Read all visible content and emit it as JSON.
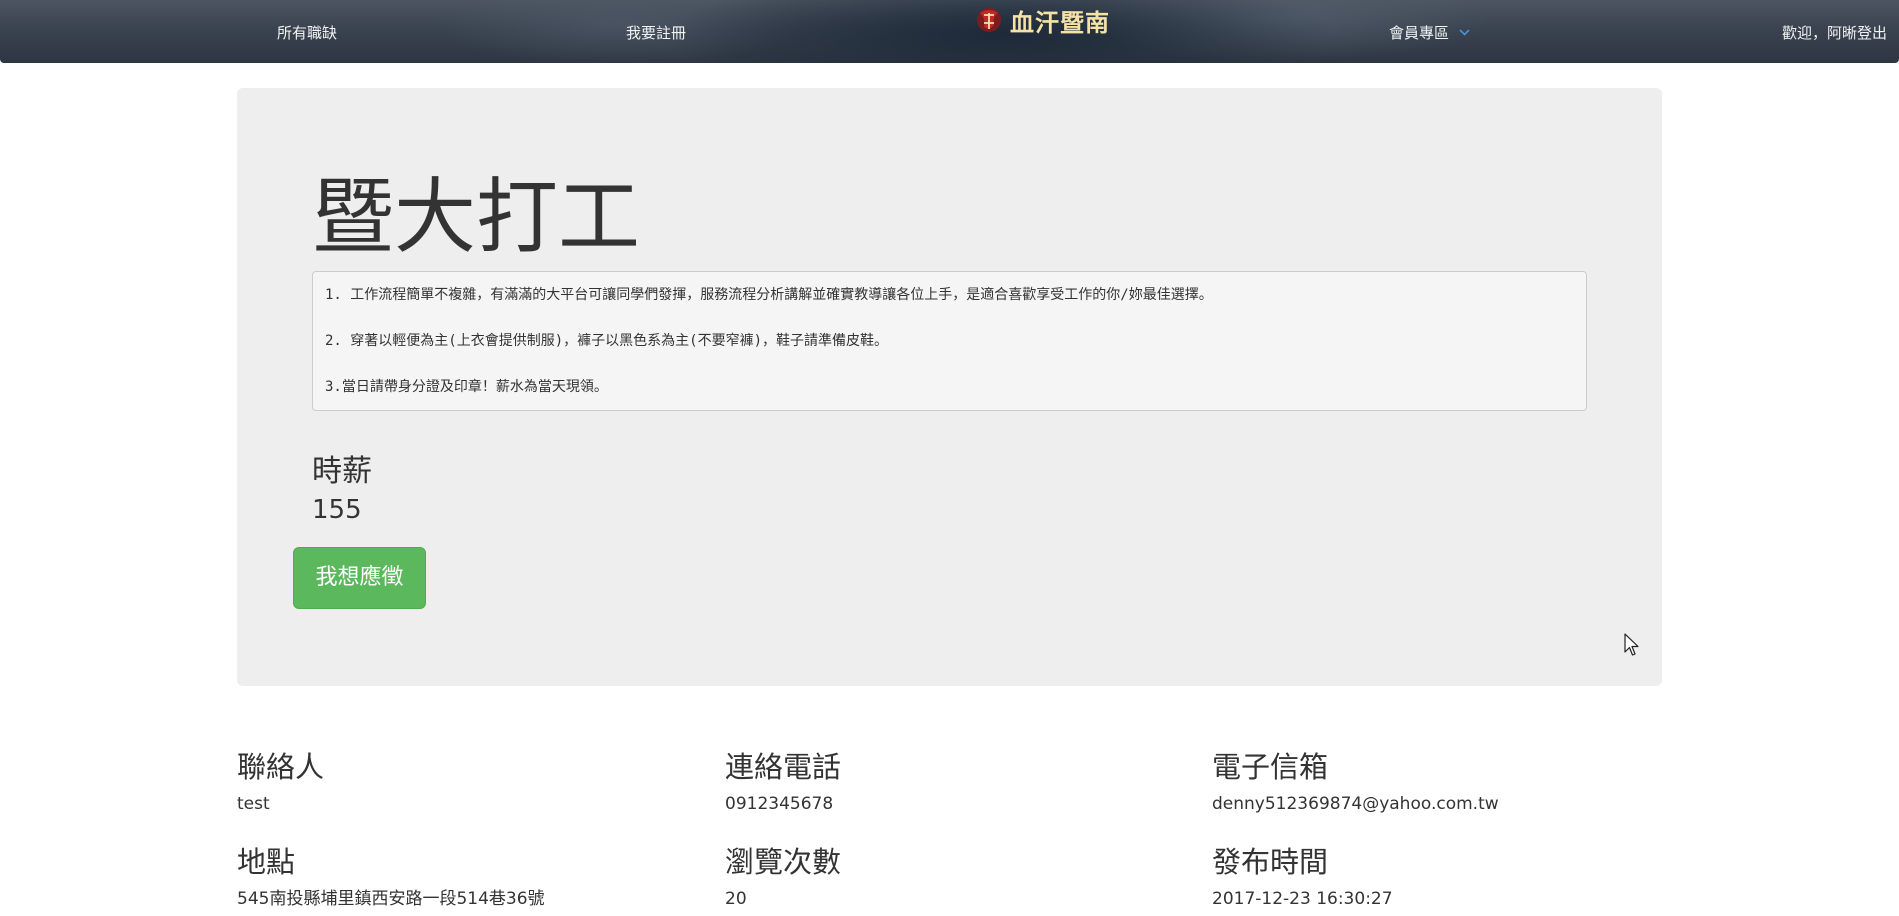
{
  "nav": {
    "all_jobs": "所有職缺",
    "register": "我要註冊",
    "brand": "血汗暨南",
    "member_area": "會員專區",
    "welcome_logout": "歡迎，阿晰登出",
    "logo_icon": "brand-logo-icon",
    "dropdown_icon": "chevron-down-icon",
    "brand_color": "#f4e2a6"
  },
  "job": {
    "title": "暨大打工",
    "description_lines": [
      "1. 工作流程簡單不複雜，有滿滿的大平台可讓同學們發揮，服務流程分析講解並確實教導讓各位上手，是適合喜歡享受工作的你/妳最佳選擇。",
      "2. 穿著以輕便為主(上衣會提供制服)，褲子以黑色系為主(不要窄褲)，鞋子請準備皮鞋。",
      "3.當日請帶身分證及印章！薪水為當天現領。"
    ],
    "wage_label": "時薪",
    "wage_value": "155",
    "apply_label": "我想應徵",
    "apply_color": "#5cb85c"
  },
  "details": {
    "contact_label": "聯絡人",
    "contact_value": "test",
    "phone_label": "連絡電話",
    "phone_value": "0912345678",
    "email_label": "電子信箱",
    "email_value": "denny512369874@yahoo.com.tw",
    "location_label": "地點",
    "location_value": "545南投縣埔里鎮西安路一段514巷36號",
    "views_label": "瀏覽次數",
    "views_value": "20",
    "posted_label": "發布時間",
    "posted_value": "2017-12-23 16:30:27"
  }
}
